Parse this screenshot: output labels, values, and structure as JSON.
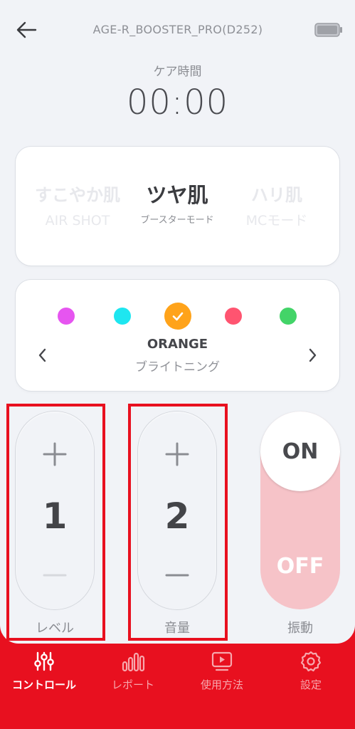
{
  "header": {
    "device_name": "AGE-R_BOOSTER_PRO(D252)"
  },
  "timer": {
    "label": "ケア時間",
    "value": "00:00"
  },
  "modes": [
    {
      "title": "すこやか肌",
      "subtitle": "AIR SHOT",
      "active": false
    },
    {
      "title": "ツヤ肌",
      "subtitle": "ブースターモード",
      "active": true
    },
    {
      "title": "ハリ肌",
      "subtitle": "MCモード",
      "active": false
    }
  ],
  "colors": {
    "dots": [
      "#e655f0",
      "#1ee6f0",
      "#ffa31a",
      "#ff5470",
      "#43d468"
    ],
    "selected_index": 2,
    "selected_name": "ORANGE",
    "selected_effect": "ブライトニング"
  },
  "controls": {
    "level": {
      "value": "1",
      "label": "レベル"
    },
    "volume": {
      "value": "2",
      "label": "音量"
    },
    "vibration": {
      "on_label": "ON",
      "off_label": "OFF",
      "label": "振動",
      "state": "ON"
    }
  },
  "theme": {
    "accent": "#e8101f",
    "background": "#f1f3f7"
  },
  "nav": {
    "items": [
      {
        "label": "コントロール",
        "icon": "sliders-icon",
        "active": true
      },
      {
        "label": "レポート",
        "icon": "bar-chart-icon",
        "active": false
      },
      {
        "label": "使用方法",
        "icon": "play-video-icon",
        "active": false
      },
      {
        "label": "設定",
        "icon": "gear-icon",
        "active": false
      }
    ]
  }
}
